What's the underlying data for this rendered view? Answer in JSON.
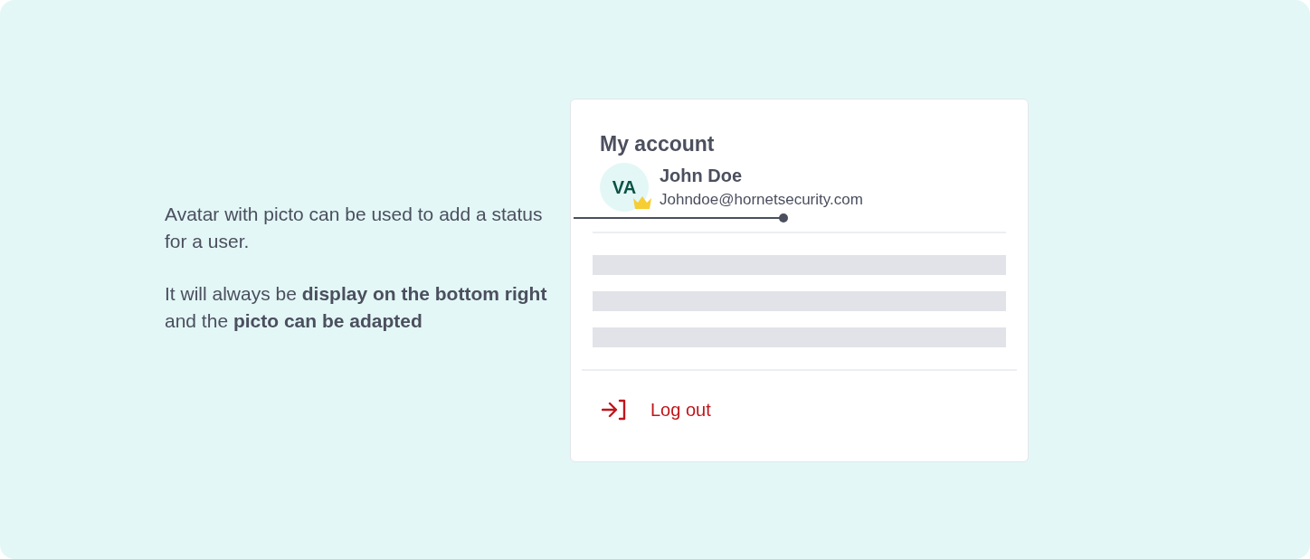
{
  "note": {
    "paragraphs": [
      "Avatar with picto can be used to add a status for a user.",
      "It will always be **display on the bottom right** and the **picto can be adapted**"
    ]
  },
  "account_card": {
    "title": "My account",
    "user": {
      "initials": "VA",
      "name": "John Doe",
      "email": "Johndoe@hornetsecurity.com"
    },
    "logout": "Log out"
  }
}
